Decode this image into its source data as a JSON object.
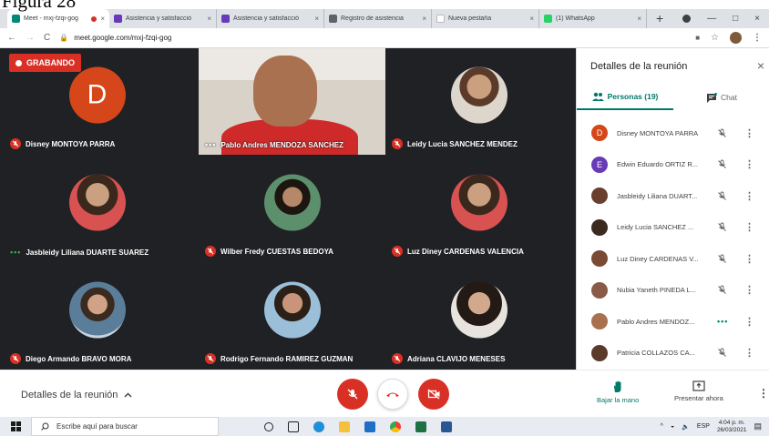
{
  "caption": "Figura 28",
  "browser": {
    "tabs": [
      {
        "title": "Meet - mxj-fzqi-gog",
        "icon_color": "#00897b",
        "recording": true,
        "active": true
      },
      {
        "title": "Asistencia y satisfacció",
        "icon_color": "#673ab7",
        "recording": false,
        "active": false
      },
      {
        "title": "Asistencia y satisfacció",
        "icon_color": "#673ab7",
        "recording": false,
        "active": false
      },
      {
        "title": "Registro de asistencia",
        "icon_color": "#5f6368",
        "recording": false,
        "active": false
      },
      {
        "title": "Nueva pestaña",
        "icon_color": "#ffffff",
        "recording": false,
        "active": false
      },
      {
        "title": "(1) WhatsApp",
        "icon_color": "#25d366",
        "recording": false,
        "active": false
      }
    ],
    "new_tab": "+",
    "close_glyph": "×",
    "url": "meet.google.com/mxj-fzqi-gog",
    "window_controls": [
      "—",
      "□",
      "×"
    ]
  },
  "meet": {
    "recording_label": "GRABANDO",
    "tiles": [
      {
        "name": "Disney MONTOYA PARRA",
        "type": "letter",
        "letter": "D",
        "status": "muted"
      },
      {
        "name": "Pablo Andres MENDOZA SANCHEZ",
        "type": "video",
        "status": "speaking"
      },
      {
        "name": "Leidy Lucia SANCHEZ MENDEZ",
        "type": "photo",
        "photo": "a",
        "status": "muted"
      },
      {
        "name": "Jasbleidy Liliana DUARTE SUAREZ",
        "type": "photo",
        "photo": "d",
        "status": "speaking-green"
      },
      {
        "name": "Wilber Fredy CUESTAS BEDOYA",
        "type": "photo",
        "photo": "e",
        "status": "muted"
      },
      {
        "name": "Luz Diney CARDENAS VALENCIA",
        "type": "photo",
        "photo": "d",
        "status": "muted"
      },
      {
        "name": "Diego Armando BRAVO MORA",
        "type": "photo",
        "photo": "c",
        "status": "muted"
      },
      {
        "name": "Rodrigo Fernando RAMIREZ GUZMAN",
        "type": "photo",
        "photo": "f",
        "status": "muted"
      },
      {
        "name": "Adriana CLAVIJO MENESES",
        "type": "photo",
        "photo": "g",
        "status": "muted"
      }
    ]
  },
  "panel": {
    "title": "Detalles de la reunión",
    "close": "×",
    "tab_people": "Personas (19)",
    "tab_chat": "Chat",
    "people": [
      {
        "name": "Disney MONTOYA PARRA",
        "letter": "D",
        "color": "#d5461a",
        "status": "muted"
      },
      {
        "name": "Edwin Eduardo ORTIZ R...",
        "letter": "E",
        "color": "#673ab7",
        "status": "muted"
      },
      {
        "name": "Jasbleidy Liliana DUART...",
        "letter": "",
        "color": "#6b3f2e",
        "status": "muted"
      },
      {
        "name": "Leidy Lucia SANCHEZ ...",
        "letter": "",
        "color": "#3b2a20",
        "status": "muted"
      },
      {
        "name": "Luz Diney CARDENAS V...",
        "letter": "",
        "color": "#7a4a35",
        "status": "muted"
      },
      {
        "name": "Nubia Yaneth PINEDA L...",
        "letter": "",
        "color": "#8a5a48",
        "status": "muted"
      },
      {
        "name": "Pablo Andres MENDOZ...",
        "letter": "",
        "color": "#a8704f",
        "status": "speaking"
      },
      {
        "name": "Patricia COLLAZOS CA...",
        "letter": "",
        "color": "#5a3a2a",
        "status": "muted"
      }
    ]
  },
  "controls": {
    "meeting_details": "Detalles de la reunión",
    "raise_hand": "Bajar la mano",
    "present": "Presentar ahora"
  },
  "taskbar": {
    "search_placeholder": "Escribe aquí para buscar",
    "lang": "ESP",
    "time": "4:04 p. m.",
    "date": "26/03/2021"
  },
  "colors": {
    "accent": "#00796b",
    "danger": "#d93025",
    "stage_bg": "#202124"
  }
}
